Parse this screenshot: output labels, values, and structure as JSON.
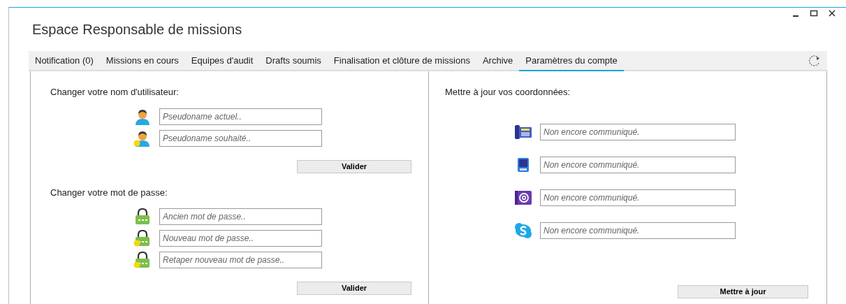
{
  "window": {
    "title": "Espace Responsable de missions"
  },
  "tabs": [
    {
      "label": "Notification (0)",
      "selected": false
    },
    {
      "label": "Missions en cours",
      "selected": false
    },
    {
      "label": "Equipes d'audit",
      "selected": false
    },
    {
      "label": "Drafts soumis",
      "selected": false
    },
    {
      "label": "Finalisation et clôture de missions",
      "selected": false
    },
    {
      "label": "Archive",
      "selected": false
    },
    {
      "label": "Paramètres du compte",
      "selected": true
    }
  ],
  "left_panel": {
    "sections": [
      {
        "heading": "Changer votre nom d'utilisateur:",
        "fields": [
          {
            "kind": "user",
            "placeholder": "Pseudoname actuel.."
          },
          {
            "kind": "user-new",
            "placeholder": "Pseudoname souhaité.."
          }
        ],
        "button": "Valider"
      },
      {
        "heading": "Changer votre mot de passe:",
        "fields": [
          {
            "kind": "lock",
            "placeholder": "Ancien mot de passe.."
          },
          {
            "kind": "lock-new",
            "placeholder": "Nouveau mot de passe.."
          },
          {
            "kind": "lock-new",
            "placeholder": "Retaper nouveau mot de passe.."
          }
        ],
        "button": "Valider"
      }
    ]
  },
  "right_panel": {
    "heading": "Mettre à jour vos coordonnées:",
    "fields": [
      {
        "kind": "desk-phone",
        "placeholder": "Non encore communiqué."
      },
      {
        "kind": "mobile",
        "placeholder": "Non encore communiqué."
      },
      {
        "kind": "email",
        "placeholder": "Non encore communiqué."
      },
      {
        "kind": "chat",
        "placeholder": "Non encore communiqué."
      }
    ],
    "button": "Mettre à jour"
  }
}
